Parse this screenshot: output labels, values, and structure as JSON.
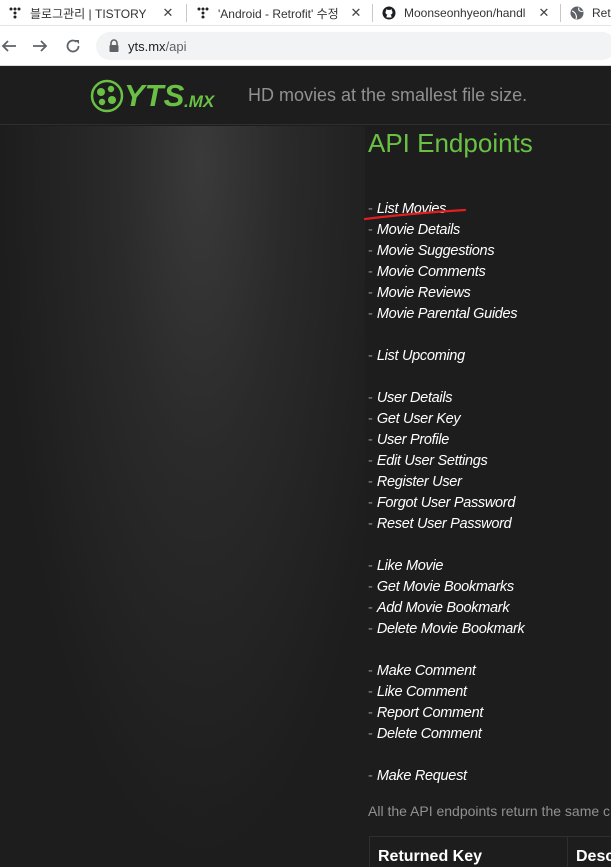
{
  "tabs": [
    {
      "title": "블로그관리 | TISTORY",
      "icon": "tistory-icon"
    },
    {
      "title": "'Android - Retrofit' 수정",
      "icon": "tistory-icon"
    },
    {
      "title": "Moonseonhyeon/handl",
      "icon": "github-icon"
    },
    {
      "title": "Retr",
      "icon": "globe-icon"
    }
  ],
  "tab_close_glyph": "✕",
  "address": {
    "host": "yts.mx",
    "path": "/api"
  },
  "site": {
    "logo_text": "YTS",
    "logo_suffix": ".MX",
    "tagline": "HD movies at the smallest file size.",
    "accent_color": "#6ac045"
  },
  "page": {
    "title": "API Endpoints",
    "dash": "- ",
    "endpoint_groups": [
      [
        "List Movies",
        "Movie Details",
        "Movie Suggestions",
        "Movie Comments",
        "Movie Reviews",
        "Movie Parental Guides"
      ],
      [
        "List Upcoming"
      ],
      [
        "User Details",
        "Get User Key",
        "User Profile",
        "Edit User Settings",
        "Register User",
        "Forgot User Password",
        "Reset User Password"
      ],
      [
        "Like Movie",
        "Get Movie Bookmarks",
        "Add Movie Bookmark",
        "Delete Movie Bookmark"
      ],
      [
        "Make Comment",
        "Like Comment",
        "Report Comment",
        "Delete Comment"
      ],
      [
        "Make Request"
      ]
    ],
    "description": "All the API endpoints return the same c",
    "table_headers": [
      "Returned Key",
      "Desc"
    ]
  }
}
